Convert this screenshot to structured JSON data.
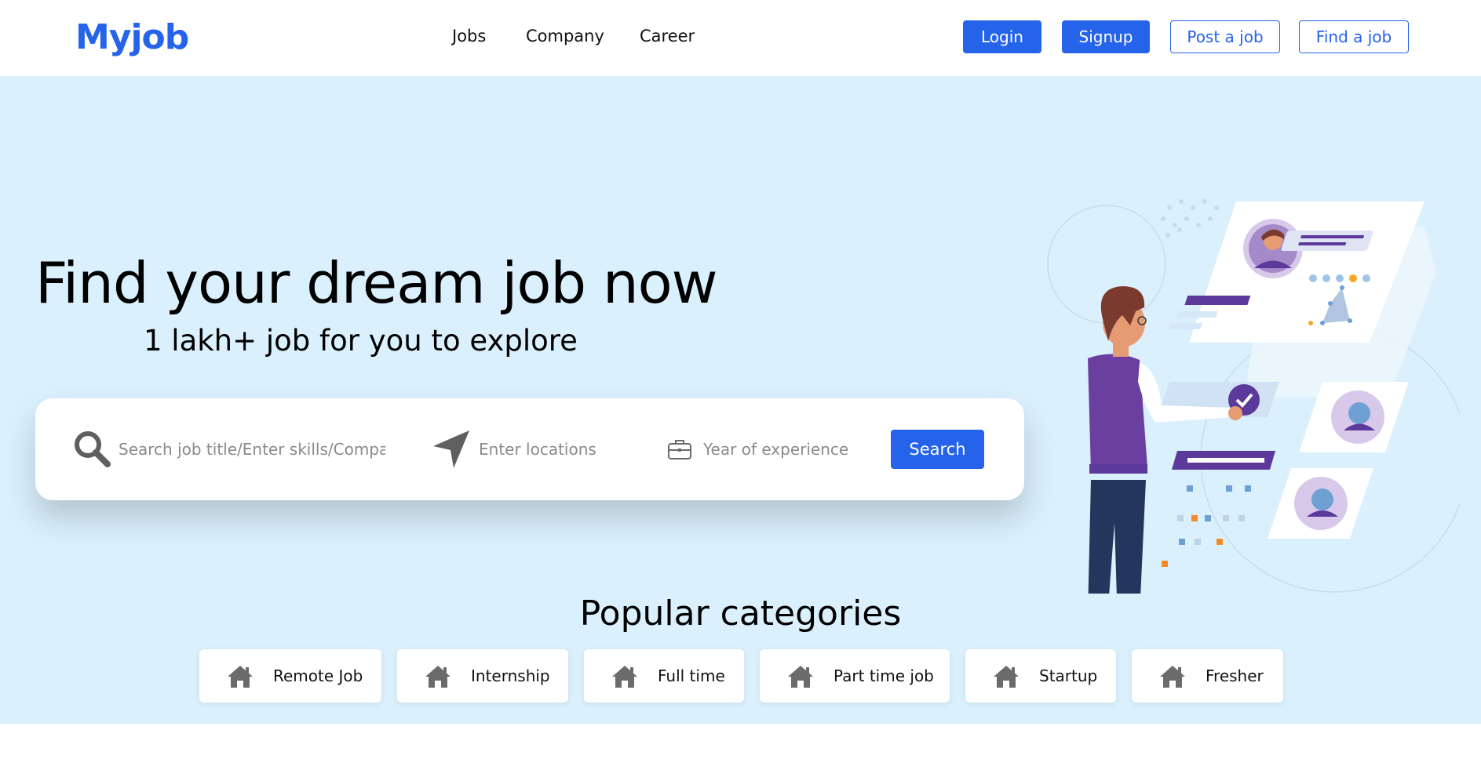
{
  "header": {
    "logo": "Myjob",
    "nav": [
      {
        "label": "Jobs"
      },
      {
        "label": "Company"
      },
      {
        "label": "Career"
      }
    ],
    "buttons": {
      "login": "Login",
      "signup": "Signup",
      "post_job": "Post a job",
      "find_job": "Find a job"
    }
  },
  "hero": {
    "title": "Find your dream job now",
    "subtitle": "1 lakh+ job for you to explore",
    "search": {
      "keyword_placeholder": "Search job title/Enter skills/Company",
      "location_placeholder": "Enter locations",
      "experience_placeholder": "Year of experience",
      "button_label": "Search"
    }
  },
  "categories": {
    "title": "Popular categories",
    "items": [
      {
        "label": "Remote Job",
        "icon": "home-icon"
      },
      {
        "label": "Internship",
        "icon": "home-icon"
      },
      {
        "label": "Full time",
        "icon": "home-icon"
      },
      {
        "label": "Part time job",
        "icon": "home-icon"
      },
      {
        "label": "Startup",
        "icon": "home-icon"
      },
      {
        "label": "Fresher",
        "icon": "home-icon"
      }
    ]
  },
  "colors": {
    "brand": "#2563eb",
    "hero_bg": "#daf0fd",
    "accent_purple": "#5b3a9b"
  }
}
